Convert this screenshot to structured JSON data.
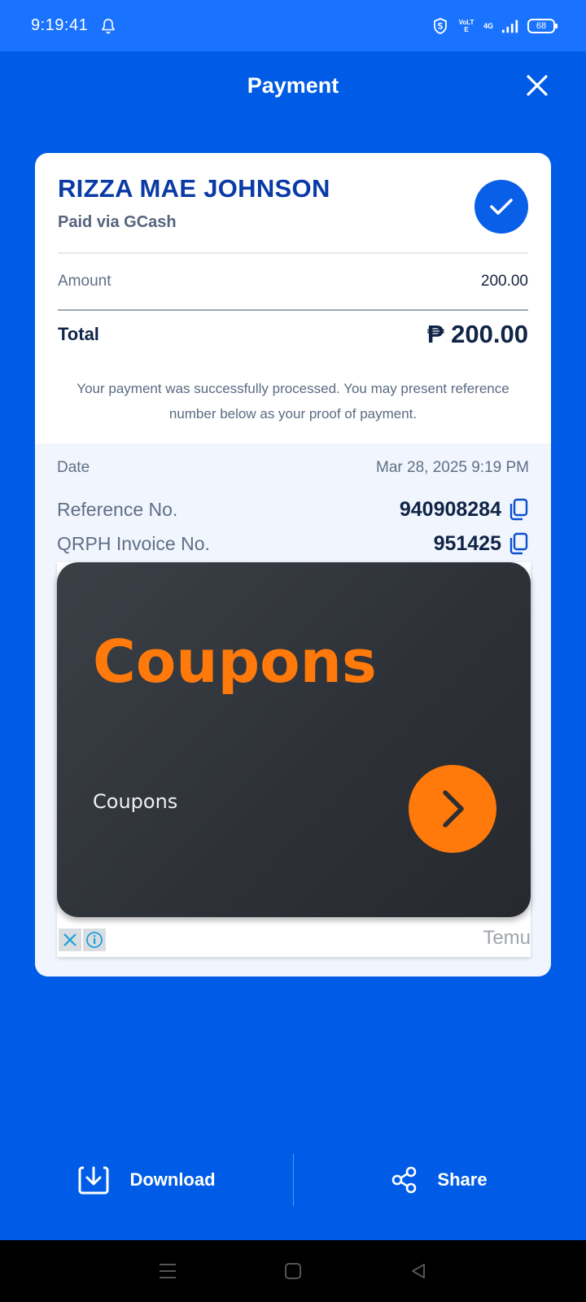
{
  "status_bar": {
    "time": "9:19:41",
    "network_label": "4G",
    "volte_label": "VoLTE",
    "battery": "68"
  },
  "header": {
    "title": "Payment"
  },
  "receipt": {
    "payee_name": "RIZZA MAE JOHNSON",
    "paid_via": "Paid via GCash",
    "amount_label": "Amount",
    "amount_value": "200.00",
    "total_label": "Total",
    "total_value": "₱ 200.00",
    "note": "Your payment was successfully processed. You may present reference number below as your proof of payment.",
    "date_label": "Date",
    "date_value": "Mar 28, 2025 9:19 PM",
    "reference_label": "Reference No.",
    "reference_value": "940908284",
    "invoice_label": "QRPH Invoice No.",
    "invoice_value": "951425"
  },
  "ad": {
    "headline": "Coupons",
    "subtext": "Coupons",
    "brand": "Temu"
  },
  "actions": {
    "download_label": "Download",
    "share_label": "Share"
  },
  "colors": {
    "primary_blue": "#005ce6",
    "status_bar_blue": "#1a73ff",
    "ad_orange": "#ff7a0a"
  }
}
